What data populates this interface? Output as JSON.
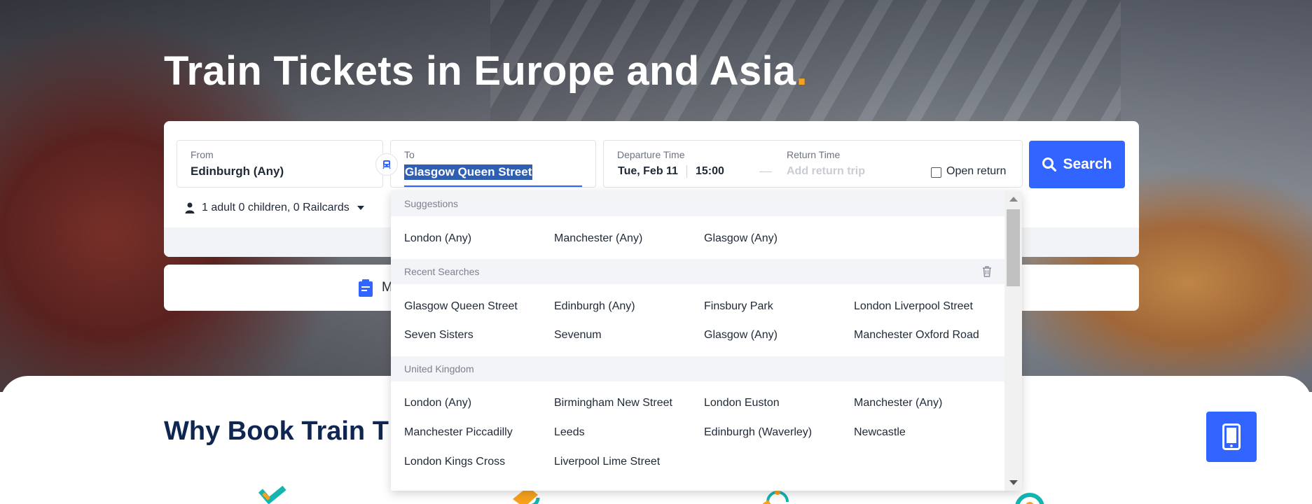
{
  "hero": {
    "title": "Train Tickets in Europe and Asia",
    "title_dot": "."
  },
  "search": {
    "from_label": "From",
    "from_value": "Edinburgh (Any)",
    "to_label": "To",
    "to_value": "Glasgow Queen Street",
    "departure_label": "Departure Time",
    "departure_date": "Tue, Feb 11",
    "departure_time": "15:00",
    "return_label": "Return Time",
    "return_placeholder": "Add return trip",
    "open_return_label": "Open return",
    "search_button": "Search",
    "passengers": "1 adult 0 children, 0 Railcards"
  },
  "card2": {
    "text": "M"
  },
  "dropdown": {
    "suggestions_label": "Suggestions",
    "suggestions": [
      "London (Any)",
      "Manchester (Any)",
      "Glasgow (Any)"
    ],
    "recent_label": "Recent Searches",
    "recent": [
      "Glasgow Queen Street",
      "Edinburgh (Any)",
      "Finsbury Park",
      "London Liverpool Street",
      "Seven Sisters",
      "Sevenum",
      "Glasgow (Any)",
      "Manchester Oxford Road"
    ],
    "uk_label": "United Kingdom",
    "uk": [
      "London (Any)",
      "Birmingham New Street",
      "London Euston",
      "Manchester (Any)",
      "Manchester Piccadilly",
      "Leeds",
      "Edinburgh (Waverley)",
      "Newcastle",
      "London Kings Cross",
      "Liverpool Lime Street"
    ]
  },
  "lower": {
    "why_title": "Why Book Train T"
  },
  "colors": {
    "accent": "#3264ff",
    "title_dot": "#f7a21b",
    "heading": "#0f2650"
  }
}
